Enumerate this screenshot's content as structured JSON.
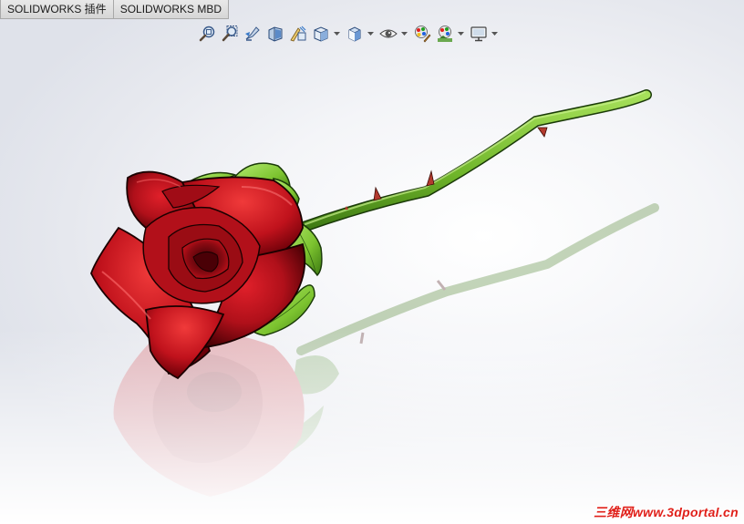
{
  "tabs": [
    {
      "label": "SOLIDWORKS 插件"
    },
    {
      "label": "SOLIDWORKS MBD"
    }
  ],
  "view_toolbar": {
    "tools": [
      {
        "icon": "zoom-to-fit-icon"
      },
      {
        "icon": "zoom-to-area-icon"
      },
      {
        "icon": "previous-view-icon"
      },
      {
        "icon": "section-view-icon"
      },
      {
        "icon": "dynamic-annotation-views-icon"
      },
      {
        "icon": "view-orientation-icon",
        "has_dropdown": true
      },
      {
        "icon": "display-style-icon",
        "has_dropdown": true
      },
      {
        "icon": "hide-show-items-icon",
        "has_dropdown": true
      },
      {
        "icon": "edit-appearance-icon"
      },
      {
        "icon": "apply-scene-icon",
        "has_dropdown": true
      },
      {
        "icon": "view-settings-icon",
        "has_dropdown": true
      }
    ]
  },
  "model": {
    "petal_color": "#c0101a",
    "petal_dark": "#5a0006",
    "stem_color": "#7cc32f",
    "leaf_color": "#8fd14a",
    "thorn_color": "#b33a2e"
  },
  "watermark": {
    "text": "三维网www.3dportal.cn",
    "color": "#e0201a"
  }
}
